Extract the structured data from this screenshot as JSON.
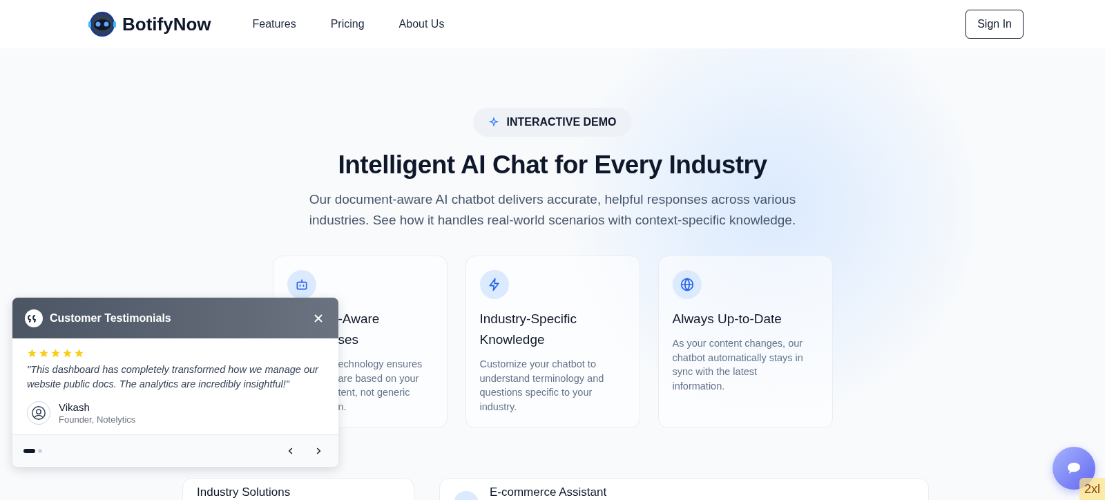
{
  "header": {
    "brand": "BotifyNow",
    "nav": [
      "Features",
      "Pricing",
      "About Us"
    ],
    "sign_in": "Sign In"
  },
  "hero": {
    "badge": "INTERACTIVE DEMO",
    "title": "Intelligent AI Chat for Every Industry",
    "subtitle": "Our document-aware AI chatbot delivers accurate, helpful responses across various industries. See how it handles real-world scenarios with context-specific knowledge."
  },
  "features": [
    {
      "kind": "robot",
      "title_lines": [
        "-Aware",
        "ses"
      ],
      "body_lines": [
        "echnology ensures",
        "are based on your",
        "tent, not generic",
        "n."
      ],
      "covered": true
    },
    {
      "kind": "bolt",
      "title_lines": [
        "Industry-Specific",
        "Knowledge"
      ],
      "body_lines": [
        "Customize your chatbot to",
        "understand terminology and",
        "questions specific to your",
        "industry."
      ],
      "covered": false
    },
    {
      "kind": "globe",
      "title_lines": [
        "Always Up-to-Date"
      ],
      "body_lines": [
        "As your content changes, our",
        "chatbot automatically stays in",
        "sync with the latest",
        "information."
      ],
      "covered": false
    }
  ],
  "bottom_cards": {
    "left_title": "Industry Solutions",
    "right_title": "E-commerce Assistant"
  },
  "testimonials": {
    "title": "Customer Testimonials",
    "stars": 5,
    "quote": "\"This dashboard has completely transformed how we manage our website public docs. The analytics are incredibly insightful!\"",
    "name": "Vikash",
    "role": "Founder, Notelytics",
    "dots": [
      {
        "selected": true
      },
      {
        "selected": false
      }
    ]
  },
  "breakpoint_badge": "2xl"
}
